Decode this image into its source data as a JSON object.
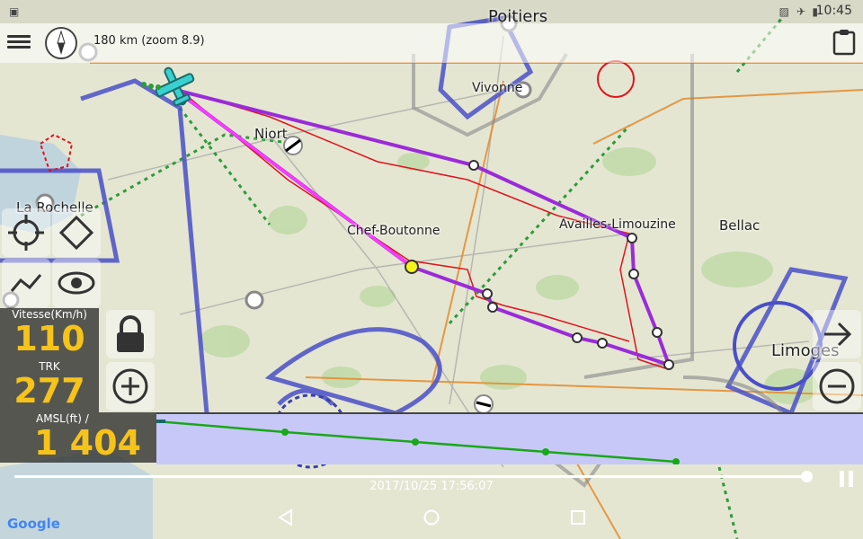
{
  "status": {
    "time": "10:45"
  },
  "topbar": {
    "zoom_text": "180 km (zoom 8.9)"
  },
  "map": {
    "labels": [
      "Poitiers",
      "Vivonne",
      "Niort",
      "La Rochelle",
      "Chef-Boutonne",
      "Availles-Limouzine",
      "Bellac",
      "Limoges"
    ],
    "route_color": "#9b2bd9",
    "track_color": "#e0141e"
  },
  "panel": {
    "speed_label": "Vitesse(Km/h)",
    "speed_value": "110",
    "trk_label": "TRK",
    "trk_value": "277",
    "amsl_label": "AMSL(ft) /",
    "amsl_value": "1 404"
  },
  "timeline": {
    "datetime": "2017/10/25 17:56:07"
  },
  "attribution": "Google",
  "icons": {
    "menu": "menu-icon",
    "compass": "compass-icon",
    "clipboard": "clipboard-icon",
    "target": "target-icon",
    "rotate": "rotate-icon",
    "graph": "graph-icon",
    "eye": "eye-icon",
    "lock": "lock-icon",
    "zoom_in": "zoom-in-icon",
    "zoom_out": "zoom-out-icon",
    "next": "arrow-right-icon",
    "pause": "pause-icon",
    "back": "back-icon",
    "home": "home-icon",
    "recents": "recents-icon"
  }
}
